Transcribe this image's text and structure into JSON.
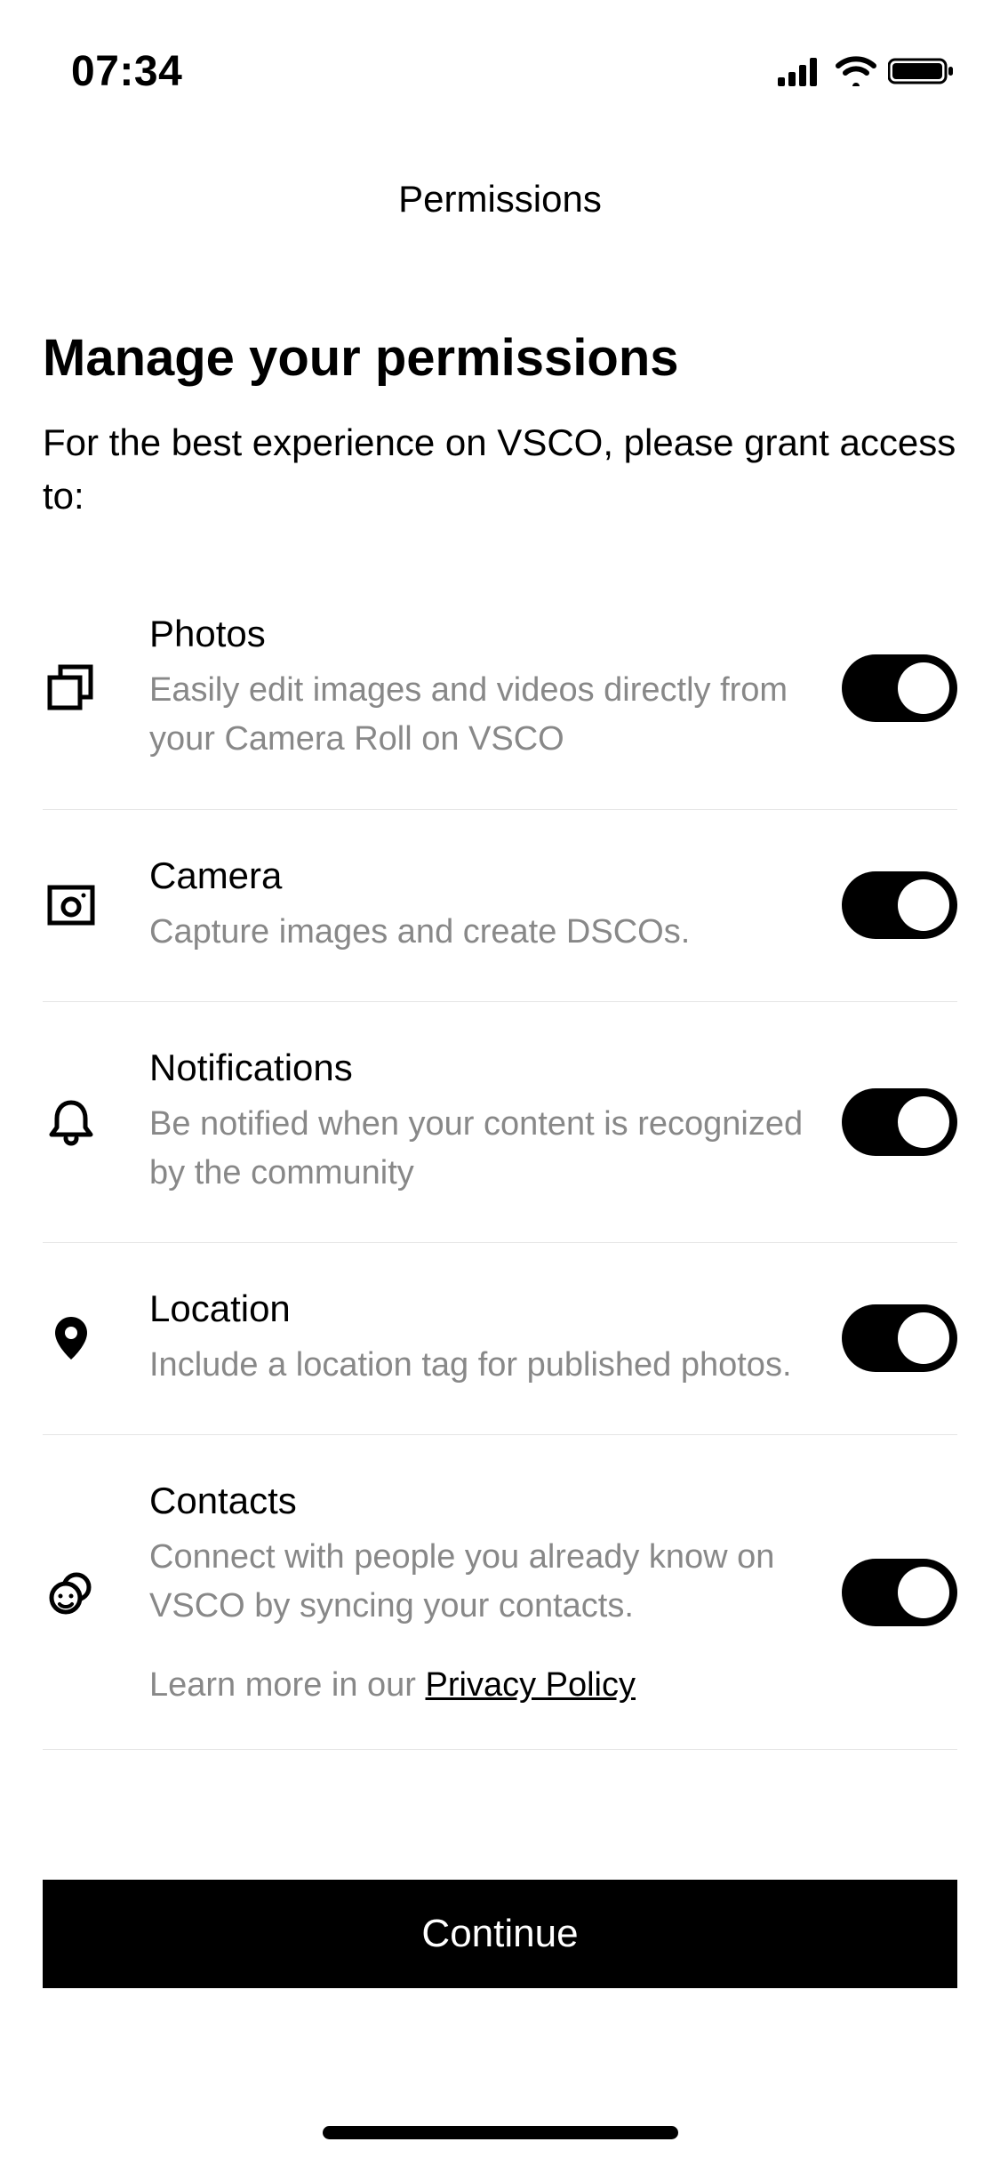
{
  "status_bar": {
    "time": "07:34"
  },
  "nav": {
    "title": "Permissions"
  },
  "header": {
    "heading": "Manage your permissions",
    "subheading": "For the best experience on VSCO, please grant access to:"
  },
  "permissions": {
    "photos": {
      "title": "Photos",
      "desc": "Easily edit images and videos directly from your Camera Roll on VSCO",
      "enabled": true
    },
    "camera": {
      "title": "Camera",
      "desc": "Capture images and create DSCOs.",
      "enabled": true
    },
    "notifications": {
      "title": "Notifications",
      "desc": "Be notified when your content is recognized by the community",
      "enabled": true
    },
    "location": {
      "title": "Location",
      "desc": "Include a location tag for published photos.",
      "enabled": true
    },
    "contacts": {
      "title": "Contacts",
      "desc": "Connect with people you already know on VSCO by syncing your contacts.",
      "extra_prefix": "Learn more in our ",
      "extra_link": "Privacy Policy",
      "enabled": true
    }
  },
  "footer": {
    "continue_label": "Continue"
  }
}
